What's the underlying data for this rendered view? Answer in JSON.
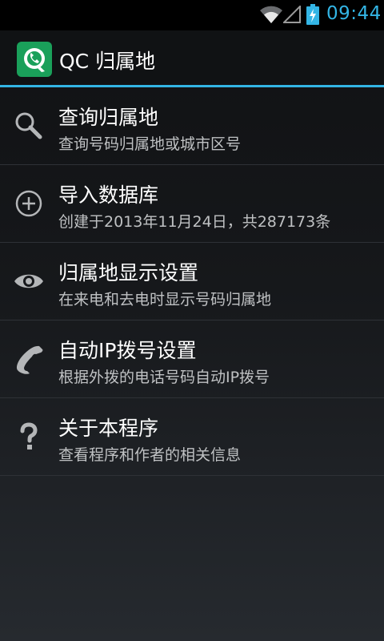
{
  "status_bar": {
    "time": "09:44",
    "icons": [
      "wifi-icon",
      "signal-icon",
      "battery-charging-icon"
    ],
    "accent_color": "#33b5e5"
  },
  "action_bar": {
    "title": "QC 归属地",
    "icon": "qc-app-logo-icon",
    "icon_color": "#1aa05a"
  },
  "menu": {
    "items": [
      {
        "icon": "search-icon",
        "label": "查询归属地",
        "desc": "查询号码归属地或城市区号"
      },
      {
        "icon": "add-circle-icon",
        "label": "导入数据库",
        "desc": "创建于2013年11月24日，共287173条"
      },
      {
        "icon": "eye-icon",
        "label": "归属地显示设置",
        "desc": "在来电和去电时显示号码归属地"
      },
      {
        "icon": "phone-icon",
        "label": "自动IP拨号设置",
        "desc": "根据外拨的电话号码自动IP拨号"
      },
      {
        "icon": "question-icon",
        "label": "关于本程序",
        "desc": "查看程序和作者的相关信息"
      }
    ]
  }
}
